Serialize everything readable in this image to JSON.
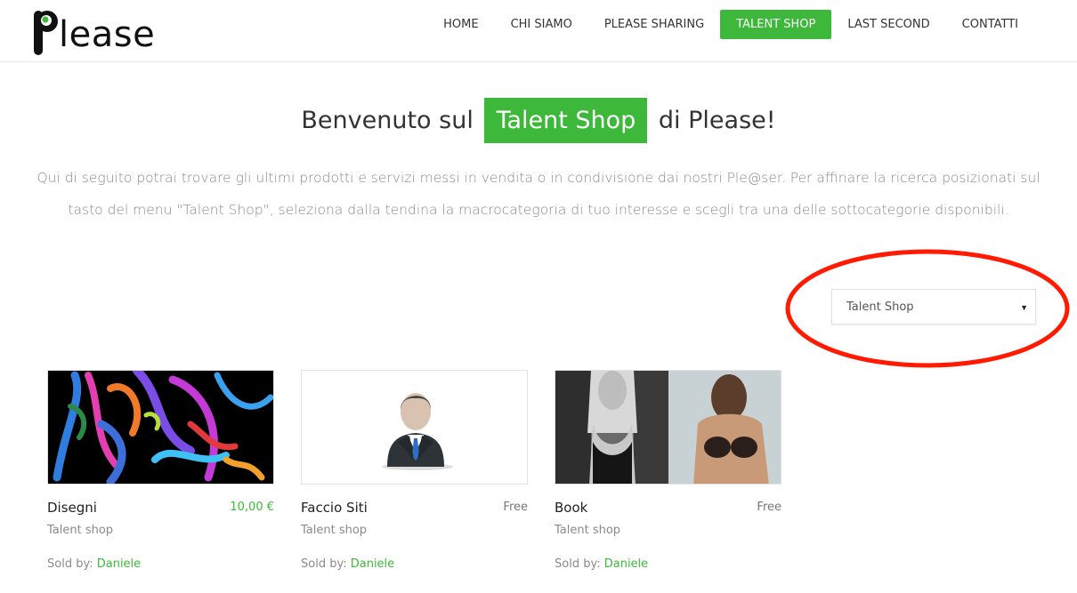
{
  "brand": {
    "logo_text": "lease",
    "accent": "#3db83a"
  },
  "nav": {
    "items": [
      {
        "label": "HOME"
      },
      {
        "label": "CHI SIAMO"
      },
      {
        "label": "PLEASE SHARING"
      },
      {
        "label": "TALENT SHOP"
      },
      {
        "label": "LAST SECOND"
      },
      {
        "label": "CONTATTI"
      }
    ]
  },
  "hero": {
    "title_before": "Benvenuto sul",
    "title_highlight": "Talent Shop",
    "title_after": "di Please!",
    "description": "Qui di seguito potrai trovare gli ultimi prodotti e servizi messi in vendita o in condivisione dai nostri Ple@ser. Per affinare la ricerca posizionati sul tasto del menu \"Talent Shop\", seleziona dalla tendina la macrocategoria di tuo interesse e scegli tra una delle sottocategorie disponibili."
  },
  "filter": {
    "selected": "Talent Shop",
    "annotation_color": "#ff1a00"
  },
  "products": [
    {
      "title": "Disegni",
      "price": "10,00 €",
      "category": "Talent shop",
      "sold_by_label": "Sold by:",
      "seller": "Daniele",
      "image": "abstract-drawing"
    },
    {
      "title": "Faccio Siti",
      "price": "Free",
      "category": "Talent shop",
      "sold_by_label": "Sold by:",
      "seller": "Daniele",
      "image": "businessman-avatar"
    },
    {
      "title": "Book",
      "price": "Free",
      "category": "Talent shop",
      "sold_by_label": "Sold by:",
      "seller": "Daniele",
      "image": "photo-book"
    }
  ]
}
